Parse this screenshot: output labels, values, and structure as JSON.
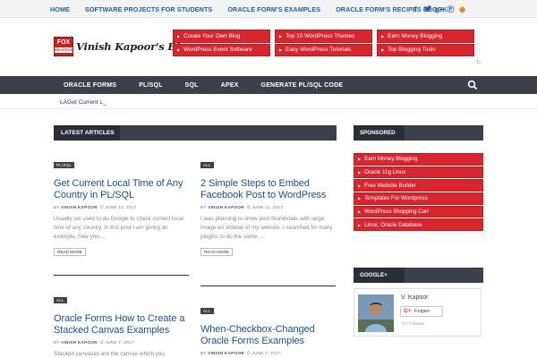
{
  "topnav": {
    "items": [
      "HOME",
      "SOFTWARE PROJECTS FOR STUDENTS",
      "ORACLE FORM'S EXAMPLES",
      "ORACLE FORM'S RECIPES EBOOK"
    ],
    "icons": [
      "facebook-icon",
      "twitter-icon",
      "google-plus-icon",
      "pinterest-icon",
      "rss-icon"
    ],
    "icon_glyphs": [
      "f",
      "‹",
      "g+",
      "Ⓟ",
      "◉"
    ]
  },
  "header": {
    "logo_badge": "FOX",
    "logo_badge_sub": "INFOTECH",
    "site_title": "Vinish Kapoor's Blog",
    "ad_links": [
      "Create Your Own Blog",
      "Top 10 WordPress Themes",
      "Earn Money Blogging",
      "WordPress Event Software",
      "Easy WordPress Tutorials",
      "Top Blogging Tools"
    ],
    "ad_choices_label": "▷"
  },
  "mainnav": {
    "items": [
      "ORACLE FORMS",
      "PL/SQL",
      "SQL",
      "APEX",
      "GENERATE PL/SQL CODE"
    ]
  },
  "ticker": {
    "text": "LAGet Current L_"
  },
  "latest": {
    "heading": "LATEST ARTICLES",
    "posts": [
      {
        "tag": "PL/SQL",
        "title": "Get Current Local Time of Any Country in PL/SQL",
        "author": "VINISH KAPOOR",
        "date": "JUNE 13, 2017",
        "excerpt": "Usually we used to do Google to check current local time of any country. In this post I am giving an example, how you ...",
        "more": "READ MORE"
      },
      {
        "tag": "ALL",
        "title": "2 Simple Steps to Embed Facebook Post to WordPress",
        "author": "VINISH KAPOOR",
        "date": "JUNE 11, 2017",
        "excerpt": "I was planning to show post thumbnails with large image on sidebar of my website. I searched for many plugins to do the same, ...",
        "more": "READ MORE"
      },
      {
        "tag": "ALL",
        "title": "Oracle Forms How to Create a Stacked Canvas Examples",
        "author": "VINISH KAPOOR",
        "date": "JUNE 7, 2017",
        "excerpt": "Stacked canvases are the canvas which you"
      },
      {
        "tag": "ALL",
        "title": "When-Checkbox-Changed Oracle Forms Examples",
        "author": "VINISH KAPOOR",
        "date": "JUNE 7, 2017"
      }
    ],
    "meta_by": "BY"
  },
  "sidebar": {
    "sponsored_heading": "SPONSORED",
    "sponsored_links": [
      "Earn Money Blogging",
      "Oracle 11g Linux",
      "Free Website Builder",
      "Templates For Wordpress",
      "WordPress Shopping Cart",
      "Linux, Oracle Database"
    ],
    "gplus_heading": "GOOGLE+",
    "gplus_name": "V. Kapoor",
    "gplus_follow": "Folgen",
    "gplus_g": "G+",
    "gplus_followers": "717 Follower"
  },
  "colors": {
    "accent_red": "#d8262e",
    "nav_dark": "#3b414b",
    "link_blue": "#1e4f8f"
  }
}
